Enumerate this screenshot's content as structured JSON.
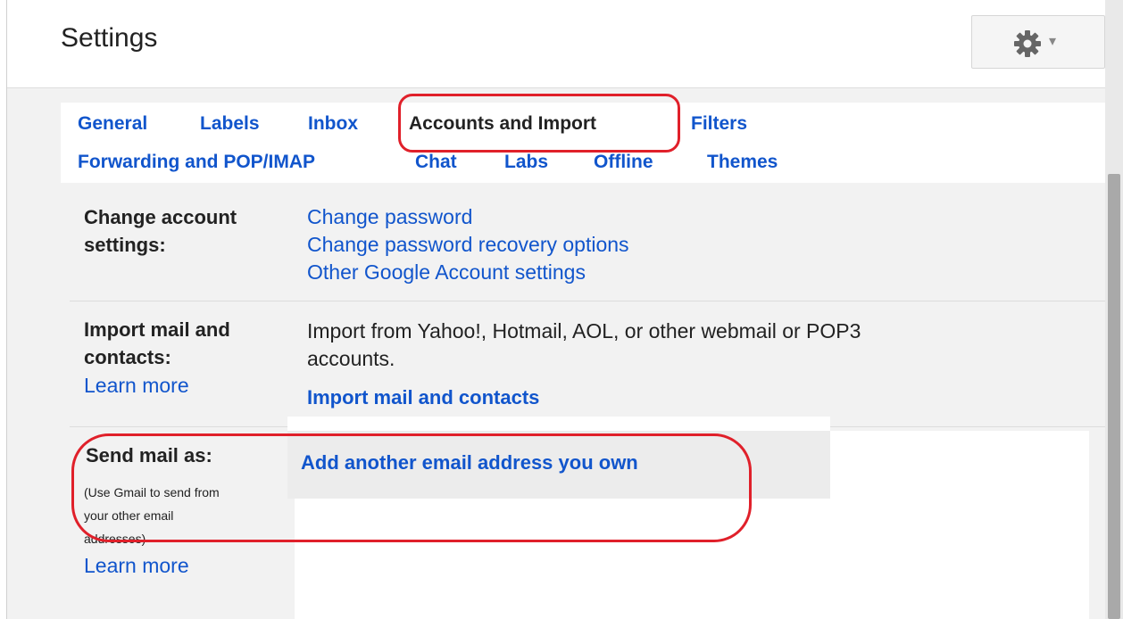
{
  "header": {
    "title": "Settings",
    "gear_icon": "gear-icon",
    "caret_icon": "chevron-down-icon"
  },
  "tabs": [
    {
      "label": "General",
      "active": false
    },
    {
      "label": "Labels",
      "active": false
    },
    {
      "label": "Inbox",
      "active": false
    },
    {
      "label": "Accounts and Import",
      "active": true
    },
    {
      "label": "Filters",
      "active": false
    },
    {
      "label": "Forwarding and POP/IMAP",
      "active": false
    },
    {
      "label": "Chat",
      "active": false
    },
    {
      "label": "Labs",
      "active": false
    },
    {
      "label": "Offline",
      "active": false
    },
    {
      "label": "Themes",
      "active": false
    }
  ],
  "sections": {
    "change_account": {
      "label_line1": "Change account",
      "label_line2": "settings:",
      "links": [
        "Change password",
        "Change password recovery options",
        "Other Google Account settings"
      ]
    },
    "import_mail": {
      "label_line1": "Import mail and",
      "label_line2": "contacts:",
      "learn_more": "Learn more",
      "description_line1": "Import from Yahoo!, Hotmail, AOL, or other webmail or POP3",
      "description_line2": "accounts.",
      "action": "Import mail and contacts"
    },
    "send_mail_as": {
      "label": "Send mail as:",
      "note_line1": "(Use Gmail to send from",
      "note_line2": "your other email",
      "note_line3": "addresses)",
      "learn_more": "Learn more",
      "action": "Add another email address you own"
    }
  },
  "colors": {
    "link": "#1155cc",
    "annotation": "#e0202a",
    "text": "#222222"
  }
}
